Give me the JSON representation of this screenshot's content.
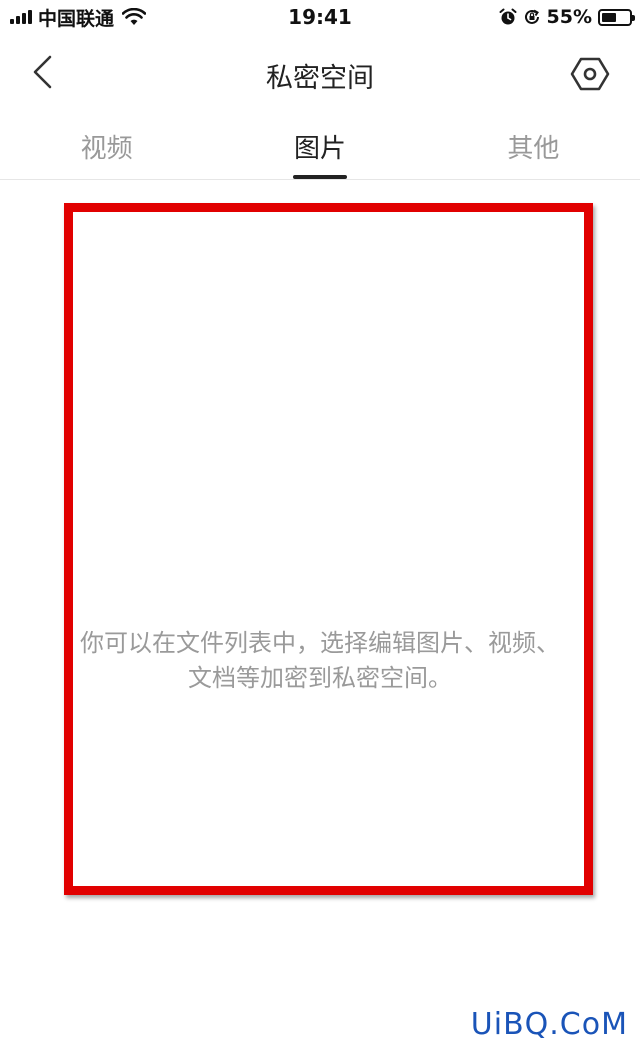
{
  "status_bar": {
    "carrier": "中国联通",
    "time": "19:41",
    "battery_percent": "55%",
    "battery_level": 0.55,
    "icons": [
      "signal-bars-icon",
      "wifi-icon",
      "alarm-icon",
      "orientation-lock-icon",
      "battery-icon"
    ]
  },
  "nav": {
    "title": "私密空间",
    "back_icon": "back-chevron-icon",
    "settings_icon": "settings-hexagon-icon"
  },
  "tabs": [
    {
      "label": "视频",
      "active": false
    },
    {
      "label": "图片",
      "active": true
    },
    {
      "label": "其他",
      "active": false
    }
  ],
  "empty_state": {
    "line1": "你可以在文件列表中，选择编辑图片、视频、",
    "line2": "文档等加密到私密空间。"
  },
  "annotation": {
    "color": "#e10000"
  },
  "watermark": "UiBQ.CoM"
}
